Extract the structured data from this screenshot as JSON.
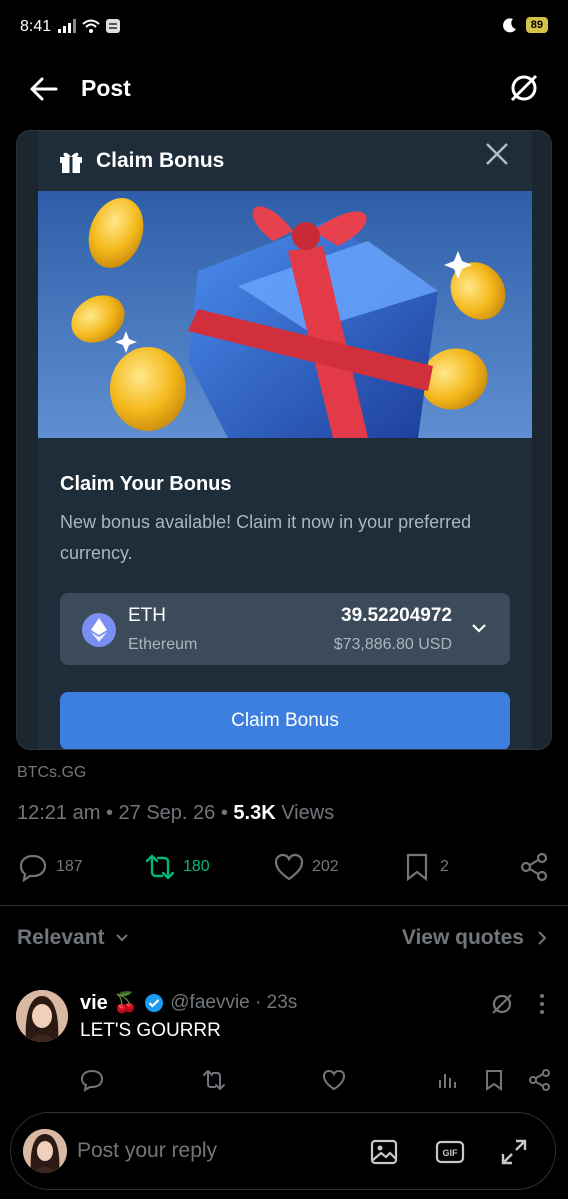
{
  "status_bar": {
    "time": "8:41",
    "battery": "89"
  },
  "header": {
    "title": "Post"
  },
  "modal": {
    "title": "Claim Bonus",
    "heading": "Claim Your Bonus",
    "description": "New bonus available! Claim it now in your preferred currency.",
    "currency": {
      "symbol": "ETH",
      "name": "Ethereum",
      "amount": "39.52204972",
      "usd": "$73,886.80 USD"
    },
    "button_label": "Claim Bonus"
  },
  "post": {
    "source": "BTCs.GG",
    "time": "12:21 am",
    "date": "27 Sep. 26",
    "views_count": "5.3K",
    "views_label": "Views",
    "replies": "187",
    "reposts": "180",
    "likes": "202",
    "bookmarks": "2"
  },
  "filter": {
    "relevant_label": "Relevant",
    "view_quotes_label": "View quotes"
  },
  "reply": {
    "name": "vie 🍒",
    "handle": "@faevvie · 23s",
    "text": "LET'S GOURRR"
  },
  "composer": {
    "placeholder": "Post your reply"
  },
  "colors": {
    "accent": "#3d7fe0",
    "repost_green": "#00ba7c",
    "verified": "#1d9bf0"
  }
}
